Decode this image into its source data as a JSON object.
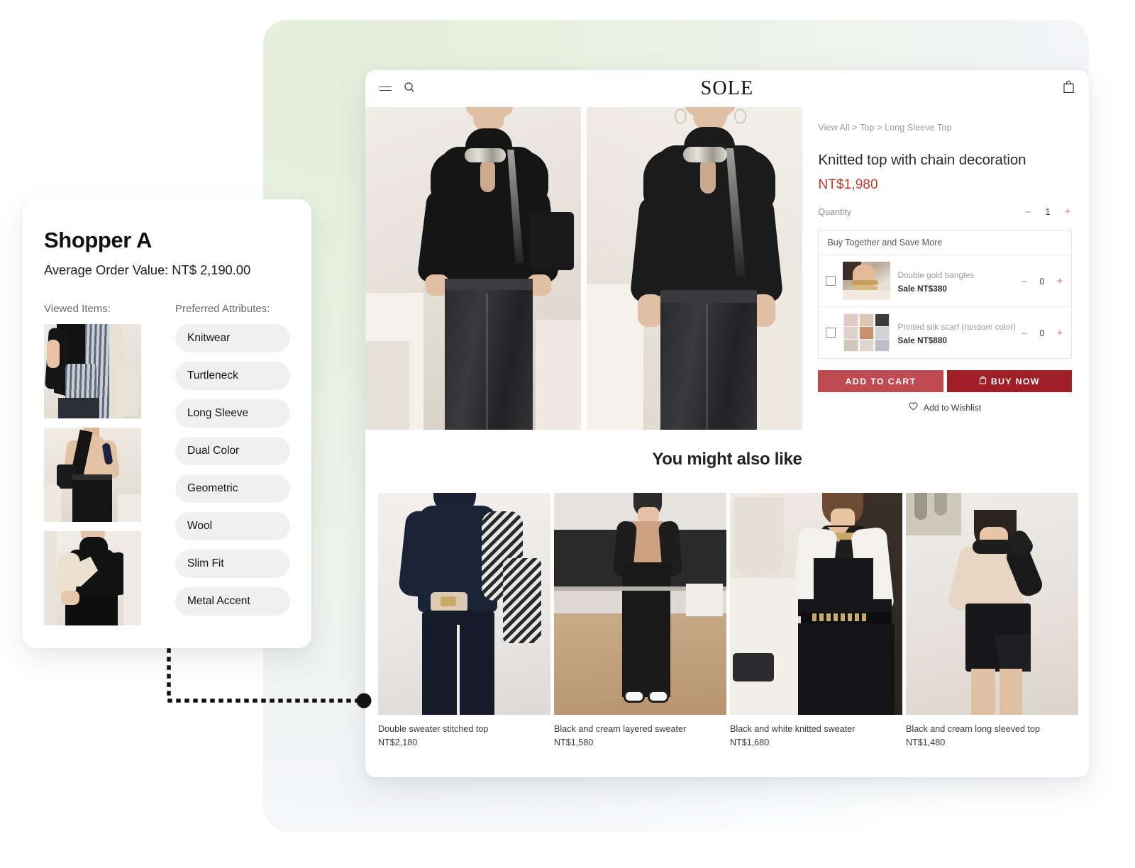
{
  "shopper": {
    "name": "Shopper A",
    "aov": "Average Order Value: NT$ 2,190.00",
    "viewed_label": "Viewed Items:",
    "attributes_label": "Preferred Attributes:",
    "viewed_items": [
      "black-knit-top-with-striped-shirt",
      "beige-turtleneck-with-shoulder-bag",
      "black-and-cream-knit-top"
    ],
    "attributes": [
      "Knitwear",
      "Turtleneck",
      "Long Sleeve",
      "Dual Color",
      "Geometric",
      "Wool",
      "Slim Fit",
      "Metal Accent"
    ]
  },
  "store": {
    "brand": "SOLE",
    "icons": {
      "menu": "hamburger-icon",
      "search": "search-icon",
      "cart": "shopping-bag-icon"
    },
    "breadcrumb": "View All > Top > Long Sleeve Top",
    "product": {
      "title": "Knitted top with chain decoration",
      "price": "NT$1,980",
      "quantity_label": "Quantity",
      "quantity_value": "1",
      "minus": "–",
      "plus": "+"
    },
    "bundle": {
      "title": "Buy Together and Save More",
      "items": [
        {
          "name": "Double gold bangles",
          "sale": "Sale NT$380",
          "qty": "0",
          "thumb": "gold-bangles-photo"
        },
        {
          "name": "Printed silk scarf (random color)",
          "sale": "Sale NT$880",
          "qty": "0",
          "thumb": "silk-scarf-grid-photo"
        }
      ]
    },
    "cta": {
      "add_to_cart": "ADD TO CART",
      "buy_now": "BUY NOW",
      "wishlist": "Add to Wishlist"
    },
    "recommendations": {
      "heading": "You might also like",
      "items": [
        {
          "name": "Double sweater stitched top",
          "price": "NT$2,180"
        },
        {
          "name": "Black and cream layered sweater",
          "price": "NT$1,580"
        },
        {
          "name": "Black and white knitted sweater",
          "price": "NT$1,680"
        },
        {
          "name": "Black and cream long sleeved top",
          "price": "NT$1,480"
        }
      ]
    }
  },
  "colors": {
    "accent_red": "#c0392b",
    "add_to_cart_bg": "#bf4b52",
    "buy_now_bg": "#a01f27",
    "backdrop_green": "#e6f0dc",
    "chip_bg": "#f0f0f0"
  }
}
